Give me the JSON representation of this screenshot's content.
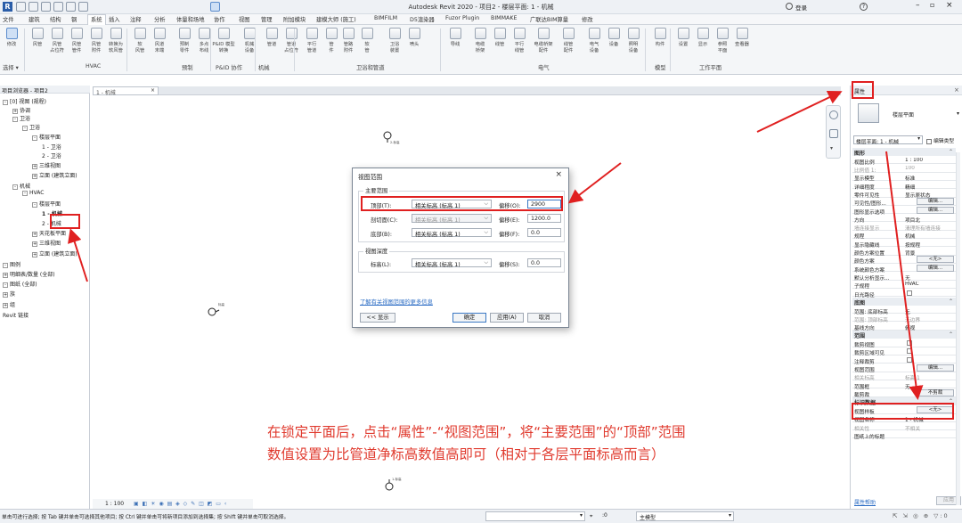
{
  "app": {
    "title": "Autodesk Revit 2020 - 项目2 - 楼层平面: 1 - 机械",
    "login": "登录"
  },
  "tabs": [
    "文件",
    "建筑",
    "结构",
    "钢",
    "系统",
    "插入",
    "注释",
    "分析",
    "体量和场地",
    "协作",
    "视图",
    "管理",
    "附加模块",
    "建模大师 (施工)",
    "BIMFILM",
    "D5渲染器",
    "Fuzor Plugin",
    "BIMMAKE",
    "广联达BIM算量",
    "修改"
  ],
  "active_tab": "系统",
  "ribbon": {
    "buttons": [
      "修改",
      "风管",
      "风管\n占位符",
      "风管\n管件",
      "风管\n附件",
      "转换为\n软风管",
      "软\n风管",
      "风道\n末端",
      "预制\n零件",
      "多点\n布线",
      "P&ID 模型转换",
      "机械\n设备",
      "管道",
      "管道\n占位符",
      "平行\n管道",
      "管\n件",
      "管路\n附件",
      "软\n管",
      "卫浴\n装置",
      "喷头",
      "导线",
      "电缆\n桥架",
      "线管",
      "平行\n线管",
      "电缆桥架\n配件",
      "线管\n配件",
      "电气\n设备",
      "设备",
      "照明\n设备",
      "构件",
      "设置",
      "显示",
      "参照\n平面",
      "查看器"
    ],
    "groups": [
      "选择 ▾",
      "HVAC",
      "预制",
      "P&ID 协作",
      "机械",
      "卫浴和管道",
      "电气",
      "模型",
      "工作平面"
    ]
  },
  "browser": {
    "header": "项目浏览器 - 项目2",
    "items": [
      {
        "label": "[0] 视图 (规程)",
        "level": 0,
        "exp": "-"
      },
      {
        "label": "协调",
        "level": 1,
        "exp": "+"
      },
      {
        "label": "卫浴",
        "level": 1,
        "exp": "-"
      },
      {
        "label": "卫浴",
        "level": 2,
        "exp": "-"
      },
      {
        "label": "楼层平面",
        "level": 3,
        "exp": "-"
      },
      {
        "label": "1 - 卫浴",
        "level": 4,
        "exp": ""
      },
      {
        "label": "2 - 卫浴",
        "level": 4,
        "exp": ""
      },
      {
        "label": "三维视图",
        "level": 3,
        "exp": "+"
      },
      {
        "label": "立面 (建筑立面)",
        "level": 3,
        "exp": "+"
      },
      {
        "label": "机械",
        "level": 1,
        "exp": "-"
      },
      {
        "label": "HVAC",
        "level": 2,
        "exp": "-"
      },
      {
        "label": "楼层平面",
        "level": 3,
        "exp": "-"
      },
      {
        "label": "1 - 机械",
        "level": 4,
        "exp": "",
        "bold": true
      },
      {
        "label": "2 - 机械",
        "level": 4,
        "exp": ""
      },
      {
        "label": "天花板平面",
        "level": 3,
        "exp": "+"
      },
      {
        "label": "三维视图",
        "level": 3,
        "exp": "+"
      },
      {
        "label": "立面 (建筑立面)",
        "level": 3,
        "exp": "+"
      },
      {
        "label": "图例",
        "level": 0,
        "exp": "-"
      },
      {
        "label": "明细表/数量 (全部)",
        "level": 0,
        "exp": "+"
      },
      {
        "label": "图纸 (全部)",
        "level": 0,
        "exp": "-"
      },
      {
        "label": "族",
        "level": 0,
        "exp": "+"
      },
      {
        "label": "组",
        "level": 0,
        "exp": "+"
      },
      {
        "label": "Revit 链接",
        "level": 0,
        "exp": ""
      }
    ]
  },
  "view_tab": {
    "label": "1 - 机械",
    "close": "×"
  },
  "levels": [
    {
      "label": "2-标高"
    },
    {
      "label": "标高"
    },
    {
      "label": "1-标高"
    }
  ],
  "dialog": {
    "title": "视图范围",
    "close": "×",
    "primary_range": "主要范围",
    "rows": [
      {
        "label": "顶部(T):",
        "ref": "相关标高 (标高 1)",
        "offset_label": "偏移(O):",
        "offset": "2900",
        "disabled": false
      },
      {
        "label": "剖切面(C):",
        "ref": "相关标高 (标高 1)",
        "offset_label": "偏移(E):",
        "offset": "1200.0",
        "disabled": true
      },
      {
        "label": "底部(B):",
        "ref": "相关标高 (标高 1)",
        "offset_label": "偏移(F):",
        "offset": "0.0",
        "disabled": false
      }
    ],
    "view_depth": "视图深度",
    "depth_row": {
      "label": "标高(L):",
      "ref": "相关标高 (标高 1)",
      "offset_label": "偏移(S):",
      "offset": "0.0"
    },
    "link": "了解有关视图范围的更多信息",
    "show_btn": "<< 显示",
    "ok": "确定",
    "apply": "应用(A)",
    "cancel": "取消"
  },
  "properties": {
    "header": "属性",
    "type_name": "楼层平面",
    "selector": "楼层平面: 1 - 机械",
    "edit_type": "编辑类型",
    "sections": [
      {
        "title": "图形",
        "rows": [
          {
            "k": "视图比例",
            "v": "1 : 100"
          },
          {
            "k": "比例值 1:",
            "v": "100",
            "dim": true
          },
          {
            "k": "显示模型",
            "v": "标准"
          },
          {
            "k": "详细程度",
            "v": "精细"
          },
          {
            "k": "零件可见性",
            "v": "显示原状态"
          },
          {
            "k": "可见性/图形...",
            "btn": "编辑..."
          },
          {
            "k": "图形显示选项",
            "btn": "编辑..."
          },
          {
            "k": "方向",
            "v": "项目北"
          },
          {
            "k": "墙连接显示",
            "v": "清理所有墙连接",
            "dim": true
          },
          {
            "k": "规程",
            "v": "机械"
          },
          {
            "k": "显示隐藏线",
            "v": "按规程"
          },
          {
            "k": "颜色方案位置",
            "v": "背景"
          },
          {
            "k": "颜色方案",
            "btn": "<无>"
          },
          {
            "k": "系统颜色方案",
            "btn": "编辑..."
          },
          {
            "k": "默认分析显示...",
            "v": "无"
          },
          {
            "k": "子规程",
            "v": "HVAC"
          },
          {
            "k": "日光路径",
            "cb": true
          }
        ]
      },
      {
        "title": "底图",
        "rows": [
          {
            "k": "范围: 底部标高",
            "v": "无"
          },
          {
            "k": "范围: 顶部标高",
            "v": "无边界",
            "dim": true
          },
          {
            "k": "基线方向",
            "v": "俯视"
          }
        ]
      },
      {
        "title": "范围",
        "rows": [
          {
            "k": "裁剪视图",
            "cb": true
          },
          {
            "k": "裁剪区域可见",
            "cb": true
          },
          {
            "k": "注释裁剪",
            "cb": true
          },
          {
            "k": "视图范围",
            "btn": "编辑..."
          },
          {
            "k": "相关标高",
            "v": "标高 1",
            "dim": true
          },
          {
            "k": "范围框",
            "v": "无"
          },
          {
            "k": "截剪裁",
            "btn": "不剪裁"
          }
        ]
      },
      {
        "title": "标识数据",
        "rows": [
          {
            "k": "视图样板",
            "btn": "<无>"
          },
          {
            "k": "视图名称",
            "v": "1 - 机械"
          },
          {
            "k": "相关性",
            "v": "不相关",
            "dim": true
          },
          {
            "k": "图纸上的标题",
            "v": ""
          }
        ]
      }
    ],
    "help": "属性帮助",
    "apply": "应用"
  },
  "scale_text": "1 : 100",
  "annotation": {
    "line1": "在锁定平面后，点击“属性”-“视图范围”，将“主要范围”的“顶部”范围",
    "line2": "数值设置为比管道净标高数值高即可（相对于各层平面标高而言）"
  },
  "status": {
    "text": "单击可进行选择; 按 Tab 键并单击可选择其他项目; 按 Ctrl 键并单击可将新项目添加到选择集; 按 Shift 键并单击可取消选择。",
    "zero": ":0",
    "model": "主模型"
  },
  "colors": {
    "annotation": "#e03a2e",
    "highlight": "#e02020",
    "accent": "#2b6cc4"
  }
}
